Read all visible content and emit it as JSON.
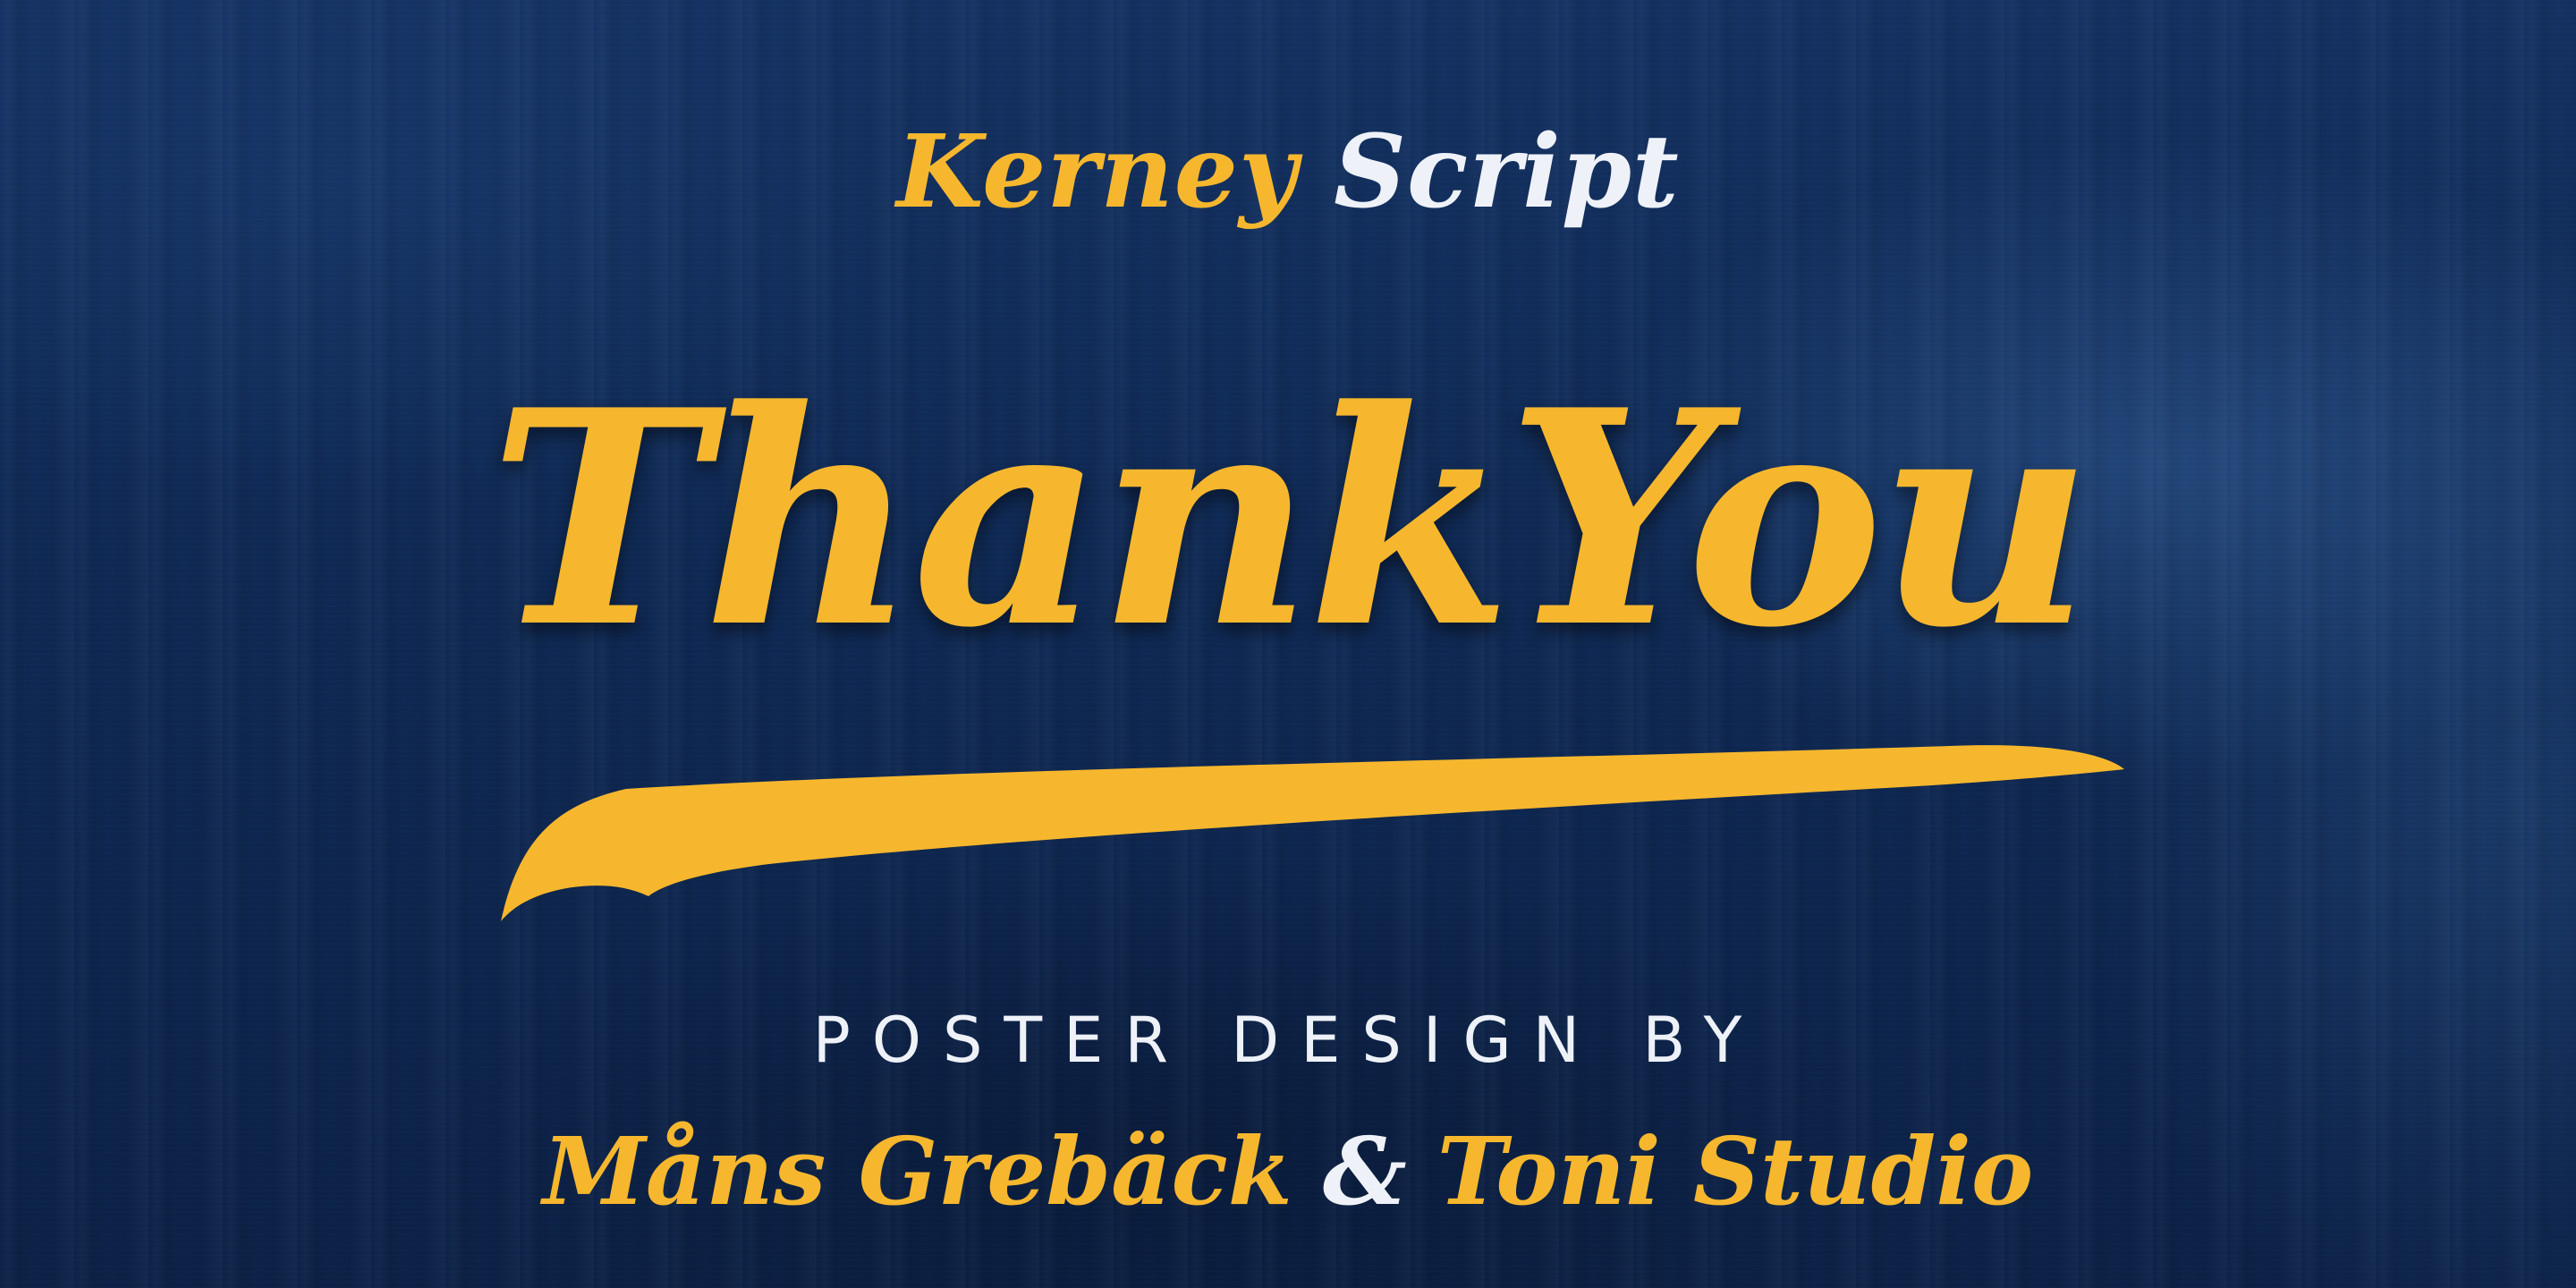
{
  "header": {
    "word_yellow": "Kerney",
    "word_white": "Script"
  },
  "headline": "ThankYou",
  "tagline": "POSTER DESIGN BY",
  "credits": {
    "name_one": "Måns Grebäck",
    "ampersand": "&",
    "name_two": "Toni Studio"
  },
  "colors": {
    "background": "#102a52",
    "accent_yellow": "#f6b72e",
    "white": "#eef2f8"
  }
}
